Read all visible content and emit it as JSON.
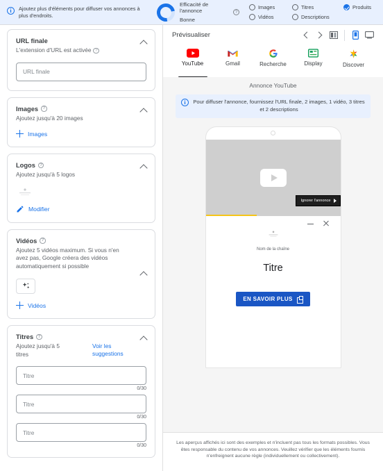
{
  "topbar": {
    "info_text": "Ajoutez plus d'éléments pour diffuser vos annonces à plus d'endroits.",
    "strength_label": "Efficacité de l'annonce",
    "strength_value": "Bonne",
    "help_glyph": "?",
    "info_glyph": "i",
    "checklist": [
      {
        "label": "Images",
        "done": false
      },
      {
        "label": "Titres",
        "done": false
      },
      {
        "label": "Produits",
        "done": true
      },
      {
        "label": "Vidéos",
        "done": false
      },
      {
        "label": "Descriptions",
        "done": false
      }
    ]
  },
  "left": {
    "url_card": {
      "title": "URL finale",
      "subtitle": "L'extension d'URL est activée",
      "input_placeholder": "URL finale",
      "input_value": ""
    },
    "images_card": {
      "title": "Images",
      "subtitle": "Ajoutez jusqu'à 20 images",
      "add_label": "Images"
    },
    "logos_card": {
      "title": "Logos",
      "subtitle": "Ajoutez jusqu'à 5 logos",
      "edit_label": "Modifier"
    },
    "videos_card": {
      "title": "Vidéos",
      "subtitle": "Ajoutez 5 vidéos maximum. Si vous n'en avez pas, Google créera des vidéos automatiquement si possible",
      "add_label": "Vidéos"
    },
    "titles_card": {
      "title": "Titres",
      "subtitle": "Ajoutez jusqu'à 5 titres",
      "suggestions_label": "Voir les suggestions",
      "fields": [
        {
          "placeholder": "Titre",
          "value": "",
          "counter": "0/30"
        },
        {
          "placeholder": "Titre",
          "value": "",
          "counter": "0/30"
        },
        {
          "placeholder": "Titre",
          "value": "",
          "counter": "0/30"
        }
      ]
    }
  },
  "preview": {
    "header_title": "Prévisualiser",
    "platform_tabs": [
      {
        "label": "YouTube",
        "icon": "youtube-icon",
        "active": true
      },
      {
        "label": "Gmail",
        "icon": "gmail-icon",
        "active": false
      },
      {
        "label": "Recherche",
        "icon": "google-search-icon",
        "active": false
      },
      {
        "label": "Display",
        "icon": "display-icon",
        "active": false
      },
      {
        "label": "Discover",
        "icon": "discover-icon",
        "active": false
      }
    ],
    "ad_kind": "Annonce YouTube",
    "notice": "Pour diffuser l'annonce, fournissez l'URL finale, 2 images, 1 vidéo, 3 titres et 2 descriptions",
    "mock": {
      "skip_label": "Ignorer l'annonce",
      "channel_name": "Nom de la chaîne",
      "ad_title": "Titre",
      "cta_label": "EN SAVOIR PLUS"
    },
    "disclaimer": "Les aperçus affichés ici sont des exemples et n'incluent pas tous les formats possibles. Vous êtes responsable du contenu de vos annonces. Veuillez vérifier que les éléments fournis n'enfreignent aucune règle (individuellement ou collectivement)."
  },
  "colors": {
    "accent": "#1a73e8",
    "banner_bg": "#e8f0fe",
    "cta_blue": "#1a56c4"
  }
}
